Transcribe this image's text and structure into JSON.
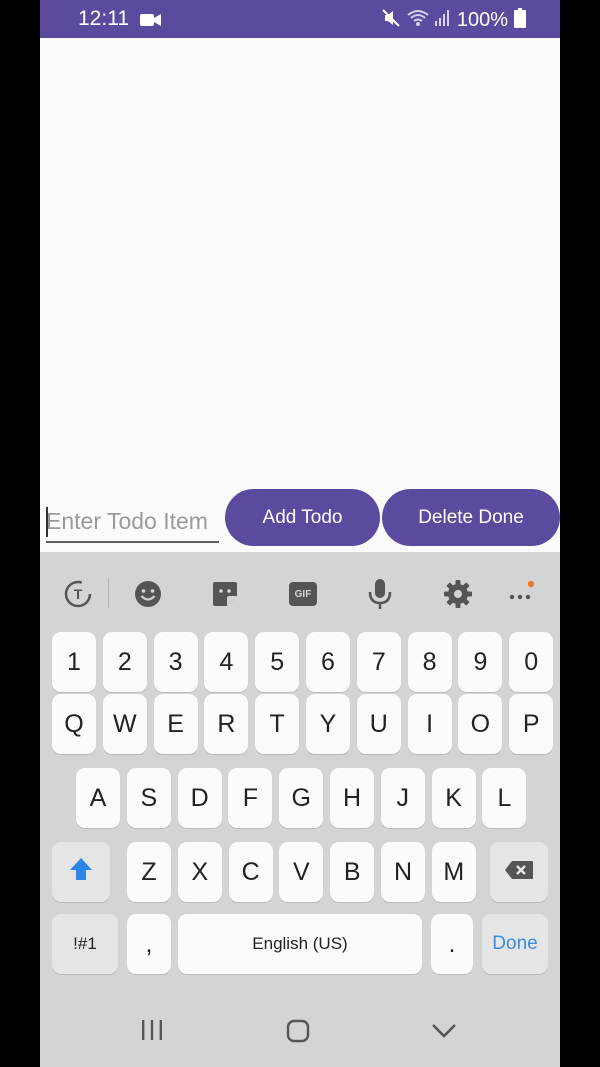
{
  "status_bar": {
    "time": "12:11",
    "battery": "100%",
    "icons": [
      "video-camera-icon",
      "mute-icon",
      "wifi-icon",
      "signal-icon",
      "battery-icon"
    ]
  },
  "todo_input": {
    "value": "",
    "placeholder": "Enter Todo Item"
  },
  "buttons": {
    "add": "Add Todo",
    "delete": "Delete Done"
  },
  "keyboard": {
    "toolbar_icons": [
      "translate-icon",
      "emoji-icon",
      "sticker-icon",
      "gif-icon",
      "microphone-icon",
      "settings-icon",
      "more-icon"
    ],
    "gif_label": "GIF",
    "number_row": [
      "1",
      "2",
      "3",
      "4",
      "5",
      "6",
      "7",
      "8",
      "9",
      "0"
    ],
    "row1": [
      "Q",
      "W",
      "E",
      "R",
      "T",
      "Y",
      "U",
      "I",
      "O",
      "P"
    ],
    "row2": [
      "A",
      "S",
      "D",
      "F",
      "G",
      "H",
      "J",
      "K",
      "L"
    ],
    "row3": [
      "Z",
      "X",
      "C",
      "V",
      "B",
      "N",
      "M"
    ],
    "symbols_label": "!#1",
    "comma": ",",
    "space_label": "English (US)",
    "period": ".",
    "done_label": "Done"
  },
  "colors": {
    "accent": "#5c4a9f",
    "keyboard_bg": "#d3d5d4",
    "done_blue": "#3a8de0"
  }
}
